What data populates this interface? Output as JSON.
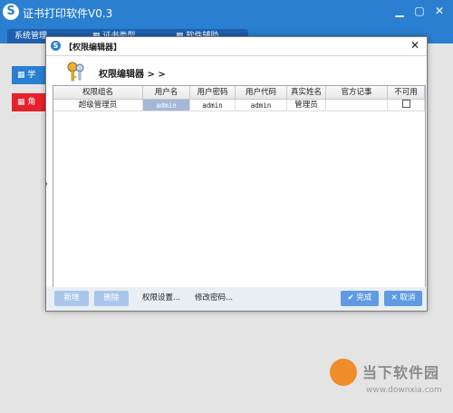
{
  "app": {
    "title": "证书打印软件V0.3",
    "tabs": [
      "系统管理",
      "证书类型",
      "软件辅助"
    ],
    "side_buttons": [
      "学",
      "角"
    ],
    "colors": {
      "titlebar": "#2a7fd0",
      "side_red": "#e8202a",
      "side_blue": "#2a7fd0"
    }
  },
  "dialog": {
    "title": "【权限编辑器】",
    "header": "权限编辑器 > >",
    "columns": [
      "权限组名",
      "用户名",
      "用户密码",
      "用户代码",
      "真实姓名",
      "官方记事",
      "不可用"
    ],
    "rows": [
      {
        "group": "超级管理员",
        "username": "admin",
        "password": "admin",
        "code": "admin",
        "realname": "管理员",
        "note": "",
        "disabled": false
      }
    ],
    "buttons": {
      "add": "新增",
      "delete": "删除",
      "permission": "权限设置...",
      "change_password": "修改密码...",
      "ok": "完成",
      "cancel": "取消"
    }
  },
  "watermark": {
    "brand": "当下软件园",
    "url": "www.downxia.com"
  }
}
